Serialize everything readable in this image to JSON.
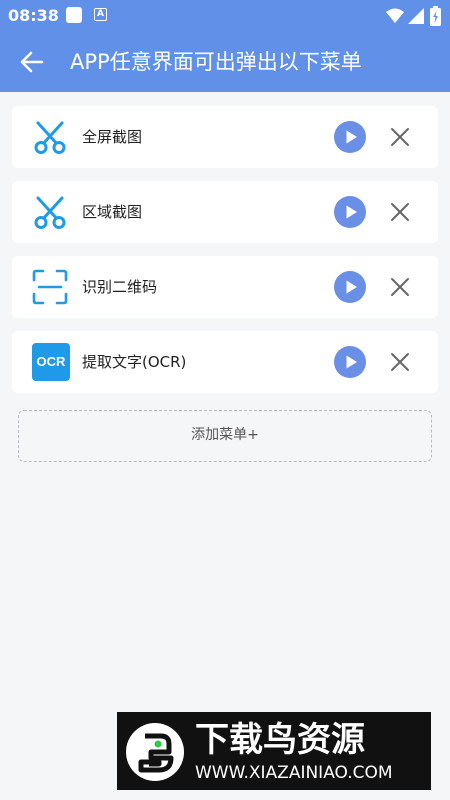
{
  "status_bar": {
    "time": "08:38",
    "notification_icons": [
      "square-icon",
      "a-icon"
    ],
    "system_icons": [
      "wifi-icon",
      "signal-icon",
      "battery-icon"
    ]
  },
  "header": {
    "title": "APP任意界面可出弹出以下菜单",
    "back_icon": "arrow-left-icon"
  },
  "menu_items": [
    {
      "icon": "scissors-icon",
      "label": "全屏截图"
    },
    {
      "icon": "scissors-icon",
      "label": "区域截图"
    },
    {
      "icon": "scan-qr-icon",
      "label": "识别二维码"
    },
    {
      "icon": "ocr-icon",
      "icon_text": "OCR",
      "label": "提取文字(OCR)"
    }
  ],
  "add_menu": {
    "label": "添加菜单+"
  },
  "watermark": {
    "title": "下载鸟资源",
    "url": "WWW.XIAZAINIAO.COM"
  },
  "colors": {
    "accent": "#6190e8",
    "play_button": "#6a8fe6",
    "icon_blue": "#1e9ae8",
    "background": "#f5f6f8"
  }
}
